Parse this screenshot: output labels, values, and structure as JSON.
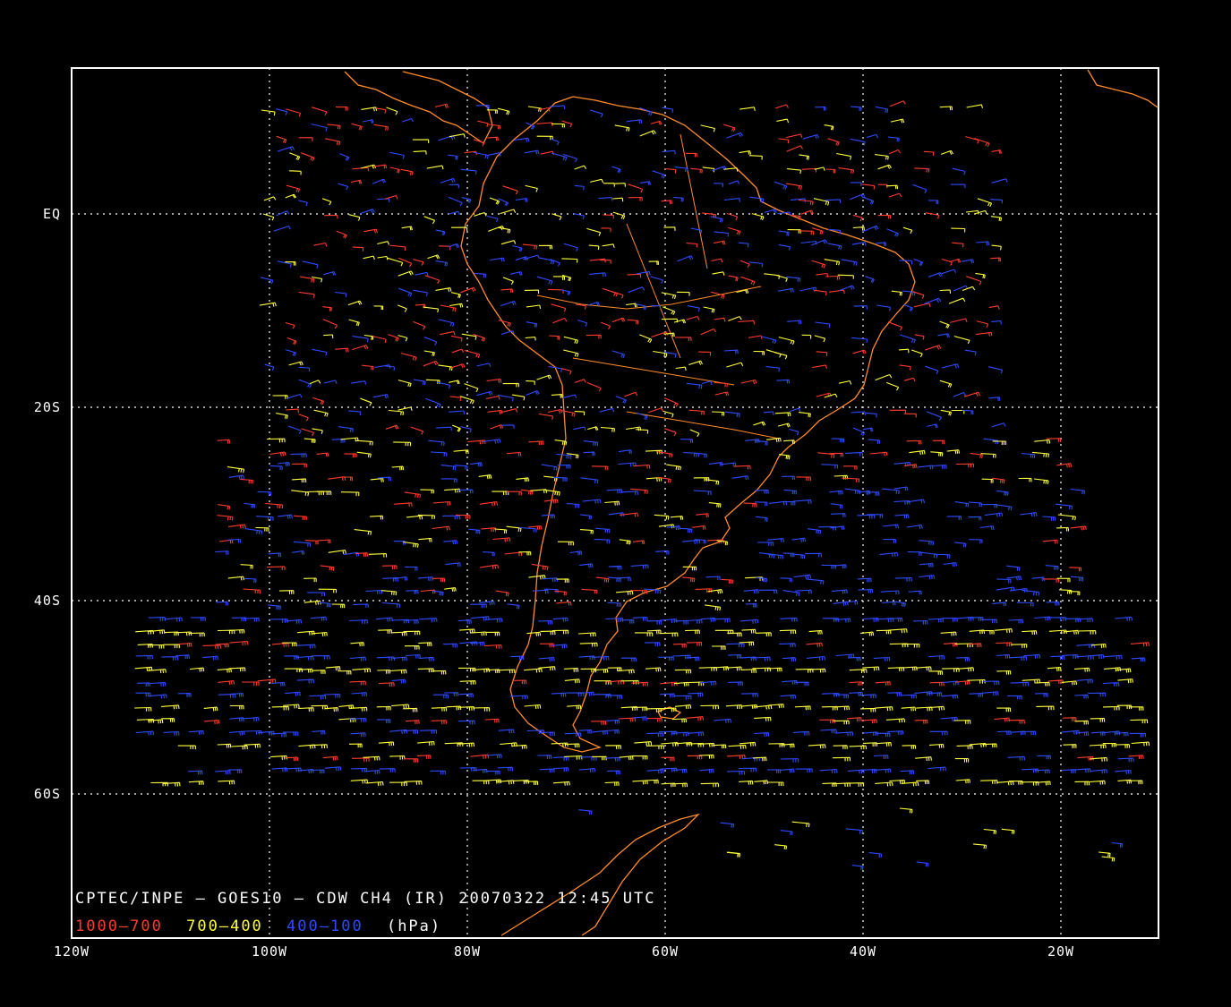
{
  "caption": {
    "line1": "CPTEC/INPE — GOES10 — CDW CH4 (IR) 20070322 12:45 UTC",
    "legend": [
      {
        "text": "1000—700",
        "color": "#ff3b2f"
      },
      {
        "text": "700—400",
        "color": "#ffff3c"
      },
      {
        "text": "400—100",
        "color": "#2f4bff"
      },
      {
        "text": "(hPa)",
        "color": "#ffffff"
      }
    ]
  },
  "axes": {
    "x_ticks": [
      "120W",
      "100W",
      "80W",
      "60W",
      "40W",
      "20W"
    ],
    "y_ticks": [
      "EQ",
      "20S",
      "40S",
      "60S"
    ]
  },
  "colors": {
    "background": "#000000",
    "frame": "#ffffff",
    "grid": "#ffffff",
    "coast": "#ff8c2a",
    "low_level": "#ff3b2f",
    "mid_level": "#ffff3c",
    "high_level": "#2f4bff"
  },
  "chart_data": {
    "type": "map",
    "projection": "lat-lon",
    "lon_range": [
      -120,
      -10
    ],
    "lat_range": [
      -74,
      15
    ],
    "grid_lons": [
      -100,
      -80,
      -60,
      -40,
      -20
    ],
    "grid_lats": [
      0,
      -20,
      -40,
      -60
    ],
    "series": [
      {
        "name": "1000—700",
        "color": "#ff3b2f"
      },
      {
        "name": "700—400",
        "color": "#ffff3c"
      },
      {
        "name": "400—100",
        "color": "#2f4bff"
      }
    ]
  }
}
